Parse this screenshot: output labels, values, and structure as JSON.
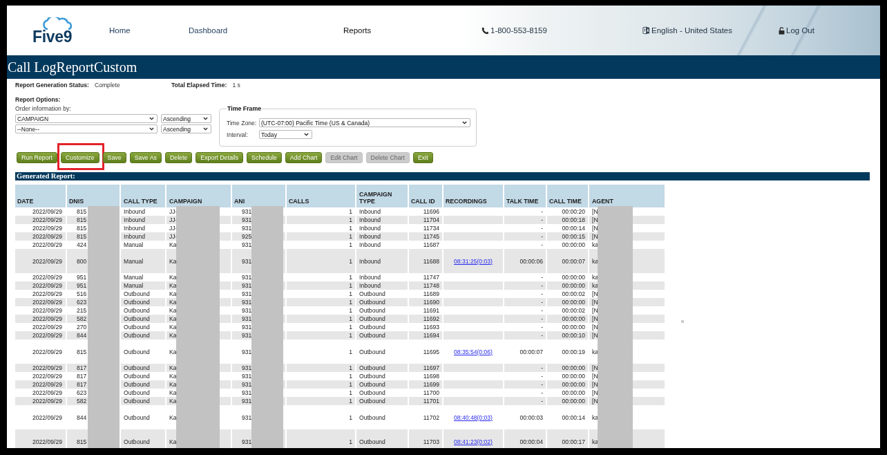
{
  "header": {
    "logo": "Five9",
    "nav": [
      {
        "label": "Home",
        "selected": false
      },
      {
        "label": "Dashboard",
        "selected": false
      },
      {
        "label": "Reports",
        "selected": true
      }
    ],
    "phone": "1-800-553-8159",
    "language": "English - United States",
    "logout": "Log Out"
  },
  "title": "Call LogReportCustom",
  "status": [
    {
      "label": "Report Generation Status:",
      "value": "Complete"
    },
    {
      "label": "Total Elapsed Time:",
      "value": "1 s"
    }
  ],
  "report_options": {
    "heading": "Report Options:",
    "order_label": "Order information by:",
    "orders": [
      {
        "field": "CAMPAIGN",
        "direction": "Ascending"
      },
      {
        "field": "--None--",
        "direction": "Ascending"
      }
    ]
  },
  "time_frame": {
    "legend": "Time Frame",
    "fields": [
      {
        "label": "Time Zone:",
        "value": "(UTC-07:00) Pacific Time (US & Canada)"
      },
      {
        "label": "Interval:",
        "value": "Today"
      }
    ]
  },
  "buttons": [
    {
      "label": "Run Report",
      "disabled": false,
      "highlighted": false
    },
    {
      "label": "Customize",
      "disabled": false,
      "highlighted": true
    },
    {
      "label": "Save",
      "disabled": false,
      "highlighted": false
    },
    {
      "label": "Save As",
      "disabled": false,
      "highlighted": false
    },
    {
      "label": "Delete",
      "disabled": false,
      "highlighted": false
    },
    {
      "label": "Export Details",
      "disabled": false,
      "highlighted": false
    },
    {
      "label": "Schedule",
      "disabled": false,
      "highlighted": false
    },
    {
      "label": "Add Chart",
      "disabled": false,
      "highlighted": false
    },
    {
      "label": "Edit Chart",
      "disabled": true,
      "highlighted": false
    },
    {
      "label": "Delete Chart",
      "disabled": true,
      "highlighted": false
    },
    {
      "label": "Exit",
      "disabled": false,
      "highlighted": false
    }
  ],
  "report": {
    "heading": "Generated Report:",
    "columns": [
      {
        "label": "DATE",
        "redacted": false
      },
      {
        "label": "DNIS",
        "redacted": true
      },
      {
        "label": "CALL TYPE",
        "redacted": false
      },
      {
        "label": "CAMPAIGN",
        "redacted": true
      },
      {
        "label": "ANI",
        "redacted": true
      },
      {
        "label": "CALLS",
        "redacted": false
      },
      {
        "label": "CAMPAIGN TYPE",
        "redacted": false
      },
      {
        "label": "CALL ID",
        "redacted": false
      },
      {
        "label": "RECORDINGS",
        "redacted": false
      },
      {
        "label": "TALK TIME",
        "redacted": false
      },
      {
        "label": "CALL TIME",
        "redacted": false
      },
      {
        "label": "AGENT",
        "redacted": true
      }
    ],
    "rows": [
      {
        "date": "2022/09/29",
        "dnis": "815",
        "call_type": "Inbound",
        "campaign": "JJ-",
        "ani": "931",
        "calls": "1",
        "campaign_type": "Inbound",
        "call_id": "11696",
        "talk_time": "-",
        "call_time": "00:00:20",
        "agent": "[N"
      },
      {
        "date": "2022/09/29",
        "dnis": "815",
        "call_type": "Inbound",
        "campaign": "JJ-",
        "ani": "931",
        "calls": "1",
        "campaign_type": "Inbound",
        "call_id": "11704",
        "talk_time": "-",
        "call_time": "00:00:18",
        "agent": "[N"
      },
      {
        "date": "2022/09/29",
        "dnis": "815",
        "call_type": "Inbound",
        "campaign": "JJ-",
        "ani": "931",
        "calls": "1",
        "campaign_type": "Inbound",
        "call_id": "11734",
        "talk_time": "-",
        "call_time": "00:00:14",
        "agent": "[N"
      },
      {
        "date": "2022/09/29",
        "dnis": "815",
        "call_type": "Inbound",
        "campaign": "JJ-",
        "ani": "925",
        "calls": "1",
        "campaign_type": "Inbound",
        "call_id": "11745",
        "talk_time": "-",
        "call_time": "00:00:15",
        "agent": "[N"
      },
      {
        "date": "2022/09/29",
        "dnis": "424",
        "call_type": "Manual",
        "campaign": "Ka",
        "ani": "931",
        "calls": "1",
        "campaign_type": "Inbound",
        "call_id": "11687",
        "talk_time": "-",
        "call_time": "00:00:00",
        "agent": "ka"
      },
      {
        "date": "2022/09/29",
        "dnis": "800",
        "call_type": "Manual",
        "campaign": "Ka",
        "ani": "931",
        "calls": "1",
        "campaign_type": "Inbound",
        "call_id": "11688",
        "recording": "08:31:25(0:03)",
        "talk_time": "00:00:06",
        "call_time": "00:00:07",
        "agent": "ka"
      },
      {
        "date": "2022/09/29",
        "dnis": "951",
        "call_type": "Manual",
        "campaign": "Ka",
        "ani": "931",
        "calls": "1",
        "campaign_type": "Inbound",
        "call_id": "11747",
        "talk_time": "-",
        "call_time": "00:00:00",
        "agent": "ka"
      },
      {
        "date": "2022/09/29",
        "dnis": "951",
        "call_type": "Manual",
        "campaign": "Ka",
        "ani": "931",
        "calls": "1",
        "campaign_type": "Inbound",
        "call_id": "11748",
        "talk_time": "-",
        "call_time": "00:00:00",
        "agent": "ka"
      },
      {
        "date": "2022/09/29",
        "dnis": "516",
        "call_type": "Outbound",
        "campaign": "Ka",
        "ani": "931",
        "calls": "1",
        "campaign_type": "Outbound",
        "call_id": "11689",
        "talk_time": "-",
        "call_time": "00:00:02",
        "agent": "[N"
      },
      {
        "date": "2022/09/29",
        "dnis": "623",
        "call_type": "Outbound",
        "campaign": "Ka",
        "ani": "931",
        "calls": "1",
        "campaign_type": "Outbound",
        "call_id": "11690",
        "talk_time": "-",
        "call_time": "00:00:00",
        "agent": "[N"
      },
      {
        "date": "2022/09/29",
        "dnis": "215",
        "call_type": "Outbound",
        "campaign": "Ka",
        "ani": "931",
        "calls": "1",
        "campaign_type": "Outbound",
        "call_id": "11691",
        "talk_time": "-",
        "call_time": "00:00:02",
        "agent": "[N"
      },
      {
        "date": "2022/09/29",
        "dnis": "582",
        "call_type": "Outbound",
        "campaign": "Ka",
        "ani": "931",
        "calls": "1",
        "campaign_type": "Outbound",
        "call_id": "11692",
        "talk_time": "-",
        "call_time": "00:00:00",
        "agent": "[N"
      },
      {
        "date": "2022/09/29",
        "dnis": "270",
        "call_type": "Outbound",
        "campaign": "Ka",
        "ani": "931",
        "calls": "1",
        "campaign_type": "Outbound",
        "call_id": "11693",
        "talk_time": "-",
        "call_time": "00:00:00",
        "agent": "[N"
      },
      {
        "date": "2022/09/29",
        "dnis": "844",
        "call_type": "Outbound",
        "campaign": "Ka",
        "ani": "931",
        "calls": "1",
        "campaign_type": "Outbound",
        "call_id": "11694",
        "talk_time": "-",
        "call_time": "00:00:10",
        "agent": "[N"
      },
      {
        "date": "2022/09/29",
        "dnis": "815",
        "call_type": "Outbound",
        "campaign": "Ka",
        "ani": "931",
        "calls": "1",
        "campaign_type": "Outbound",
        "call_id": "11695",
        "recording": "08:35:54(0:06)",
        "talk_time": "00:00:07",
        "call_time": "00:00:19",
        "agent": "ka"
      },
      {
        "date": "2022/09/29",
        "dnis": "817",
        "call_type": "Outbound",
        "campaign": "Ka",
        "ani": "931",
        "calls": "1",
        "campaign_type": "Outbound",
        "call_id": "11697",
        "talk_time": "-",
        "call_time": "00:00:00",
        "agent": "[N"
      },
      {
        "date": "2022/09/29",
        "dnis": "817",
        "call_type": "Outbound",
        "campaign": "Ka",
        "ani": "931",
        "calls": "1",
        "campaign_type": "Outbound",
        "call_id": "11698",
        "talk_time": "-",
        "call_time": "00:00:00",
        "agent": "[N"
      },
      {
        "date": "2022/09/29",
        "dnis": "817",
        "call_type": "Outbound",
        "campaign": "Ka",
        "ani": "931",
        "calls": "1",
        "campaign_type": "Outbound",
        "call_id": "11699",
        "talk_time": "-",
        "call_time": "00:00:00",
        "agent": "[N"
      },
      {
        "date": "2022/09/29",
        "dnis": "623",
        "call_type": "Outbound",
        "campaign": "Ka",
        "ani": "931",
        "calls": "1",
        "campaign_type": "Outbound",
        "call_id": "11700",
        "talk_time": "-",
        "call_time": "00:00:00",
        "agent": "[N"
      },
      {
        "date": "2022/09/29",
        "dnis": "582",
        "call_type": "Outbound",
        "campaign": "Ka",
        "ani": "931",
        "calls": "1",
        "campaign_type": "Outbound",
        "call_id": "11701",
        "talk_time": "-",
        "call_time": "00:00:00",
        "agent": "[N"
      },
      {
        "date": "2022/09/29",
        "dnis": "844",
        "call_type": "Outbound",
        "campaign": "Ka",
        "ani": "931",
        "calls": "1",
        "campaign_type": "Outbound",
        "call_id": "11702",
        "recording": "08:40:48(0:03)",
        "talk_time": "00:00:03",
        "call_time": "00:00:14",
        "agent": "ka"
      },
      {
        "date": "2022/09/29",
        "dnis": "815",
        "call_type": "Outbound",
        "campaign": "Ka",
        "ani": "931",
        "calls": "1",
        "campaign_type": "Outbound",
        "call_id": "11703",
        "recording": "08:41:23(0:02)",
        "talk_time": "00:00:04",
        "call_time": "00:00:17",
        "agent": "ka"
      }
    ]
  }
}
